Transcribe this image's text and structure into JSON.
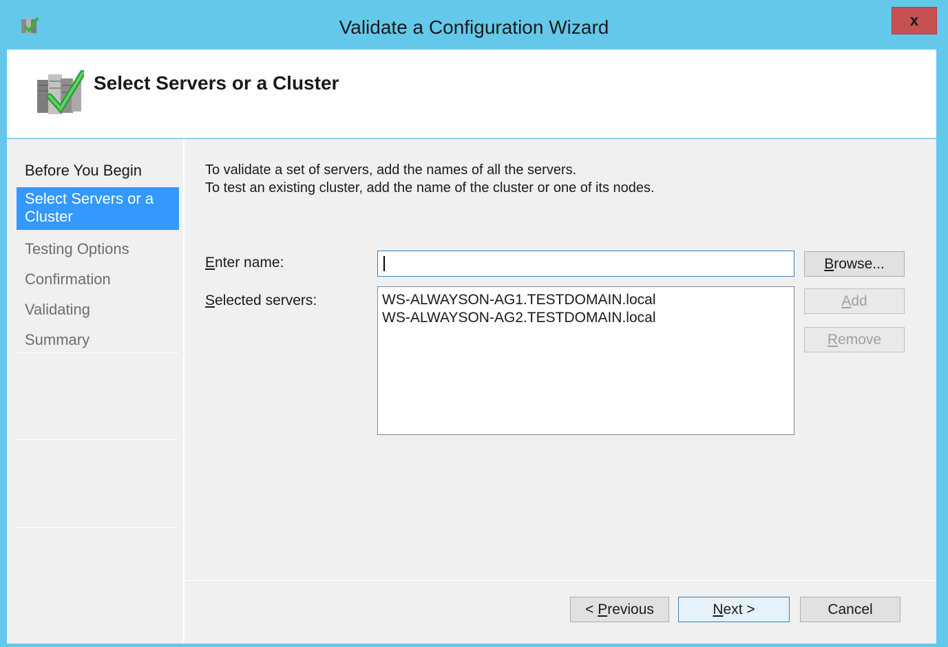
{
  "window": {
    "title": "Validate a Configuration Wizard",
    "close_label": "x"
  },
  "header": {
    "title": "Select Servers or a Cluster"
  },
  "nav": {
    "items": [
      {
        "label": "Before You Begin",
        "state": "done"
      },
      {
        "label": "Select Servers or a Cluster",
        "state": "active"
      },
      {
        "label": "Testing Options",
        "state": "pending"
      },
      {
        "label": "Confirmation",
        "state": "pending"
      },
      {
        "label": "Validating",
        "state": "pending"
      },
      {
        "label": "Summary",
        "state": "pending"
      }
    ]
  },
  "content": {
    "intro_line1": "To validate a set of servers, add the names of all the servers.",
    "intro_line2": "To test an existing cluster, add the name of the cluster or one of its nodes.",
    "enter_name_label_accel": "E",
    "enter_name_label_rest": "nter name:",
    "enter_name_value": "",
    "selected_servers_label_accel": "S",
    "selected_servers_label_rest": "elected servers:",
    "selected_servers": [
      "WS-ALWAYSON-AG1.TESTDOMAIN.local",
      "WS-ALWAYSON-AG2.TESTDOMAIN.local"
    ]
  },
  "buttons": {
    "browse_accel": "B",
    "browse_rest": "rowse...",
    "add_accel": "A",
    "add_rest": "dd",
    "remove_accel": "R",
    "remove_rest": "emove",
    "previous_pre": "< ",
    "previous_accel": "P",
    "previous_rest": "revious",
    "next_accel": "N",
    "next_rest": "ext >",
    "cancel": "Cancel"
  },
  "colors": {
    "title_bar": "#63c8ea",
    "active_nav": "#3399ff",
    "close_button": "#c75050"
  },
  "icons": {
    "app": "validate-wizard-icon",
    "header": "servers-checkmark-icon"
  }
}
